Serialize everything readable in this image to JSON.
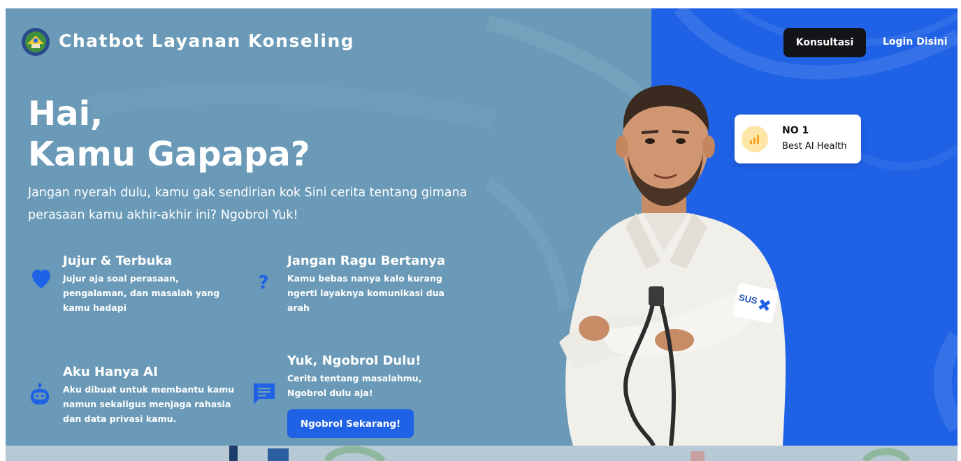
{
  "brand": {
    "title": "Chatbot Layanan Konseling",
    "logo_icon": "school-emblem-icon"
  },
  "nav": {
    "consult_label": "Konsultasi",
    "login_label": "Login Disini"
  },
  "hero": {
    "title_line1": "Hai,",
    "title_line2": "Kamu Gapapa?",
    "subtitle": "Jangan nyerah dulu, kamu gak sendirian kok Sini cerita tentang gimana perasaan kamu akhir-akhir ini? Ngobrol Yuk!"
  },
  "features": [
    {
      "icon": "heart-icon",
      "title": "Jujur & Terbuka",
      "desc": "Jujur aja soal perasaan, pengalaman, dan masalah yang kamu hadapi"
    },
    {
      "icon": "question-icon",
      "title": "Jangan Ragu Bertanya",
      "desc": "Kamu bebas nanya kalo kurang ngerti layaknya komunikasi dua arah"
    },
    {
      "icon": "robot-icon",
      "title": "Aku Hanya AI",
      "desc": "Aku dibuat untuk membantu kamu namun sekaligus menjaga rahasia dan data privasi kamu."
    },
    {
      "icon": "chat-icon",
      "title": "Yuk, Ngobrol Dulu!",
      "desc": "Cerita tentang masalahmu, Ngobrol dulu aja!"
    }
  ],
  "cta": {
    "label": "Ngobrol Sekarang!"
  },
  "badge": {
    "rank": "NO 1",
    "label": "Best AI Health",
    "icon": "bar-chart-icon"
  },
  "doctor": {
    "coat_patch": "SUS"
  },
  "colors": {
    "hero_bg": "#6a9ab7",
    "accent_blue": "#1f62e6",
    "dark_button": "#121418",
    "badge_circle": "#fde6a6",
    "badge_bars": "#f5a524"
  }
}
